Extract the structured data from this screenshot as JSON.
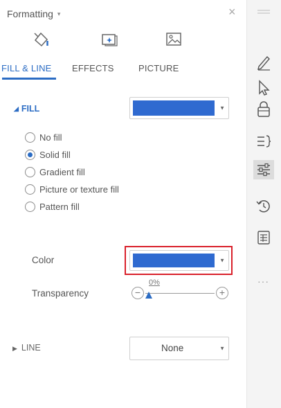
{
  "panel": {
    "title": "Formatting",
    "title_caret": "▾",
    "close": "×"
  },
  "tabs": [
    {
      "label": "FILL & LINE",
      "icon": "paint-bucket-icon",
      "active": true
    },
    {
      "label": "EFFECTS",
      "icon": "effects-icon",
      "active": false
    },
    {
      "label": "PICTURE",
      "icon": "picture-icon",
      "active": false
    }
  ],
  "fill": {
    "header": "FILL",
    "header_triangle": "◢",
    "swatch_color": "#2f6ad0",
    "options": [
      {
        "label": "No fill",
        "checked": false
      },
      {
        "label": "Solid fill",
        "checked": true
      },
      {
        "label": "Gradient fill",
        "checked": false
      },
      {
        "label": "Picture or texture fill",
        "checked": false
      },
      {
        "label": "Pattern fill",
        "checked": false
      }
    ],
    "color_label": "Color",
    "transparency_label": "Transparency",
    "transparency_value": "0%",
    "minus": "−",
    "plus": "+"
  },
  "line": {
    "header": "LINE",
    "header_triangle": "▶",
    "value": "None"
  },
  "rail": {
    "icons": [
      "pen-icon",
      "cursor-icon",
      "lock-icon",
      "text-columns-icon",
      "sliders-icon",
      "history-icon",
      "table-icon"
    ],
    "more": "···"
  },
  "colors": {
    "accent": "#2b6cc4",
    "highlight": "#d9202a"
  }
}
